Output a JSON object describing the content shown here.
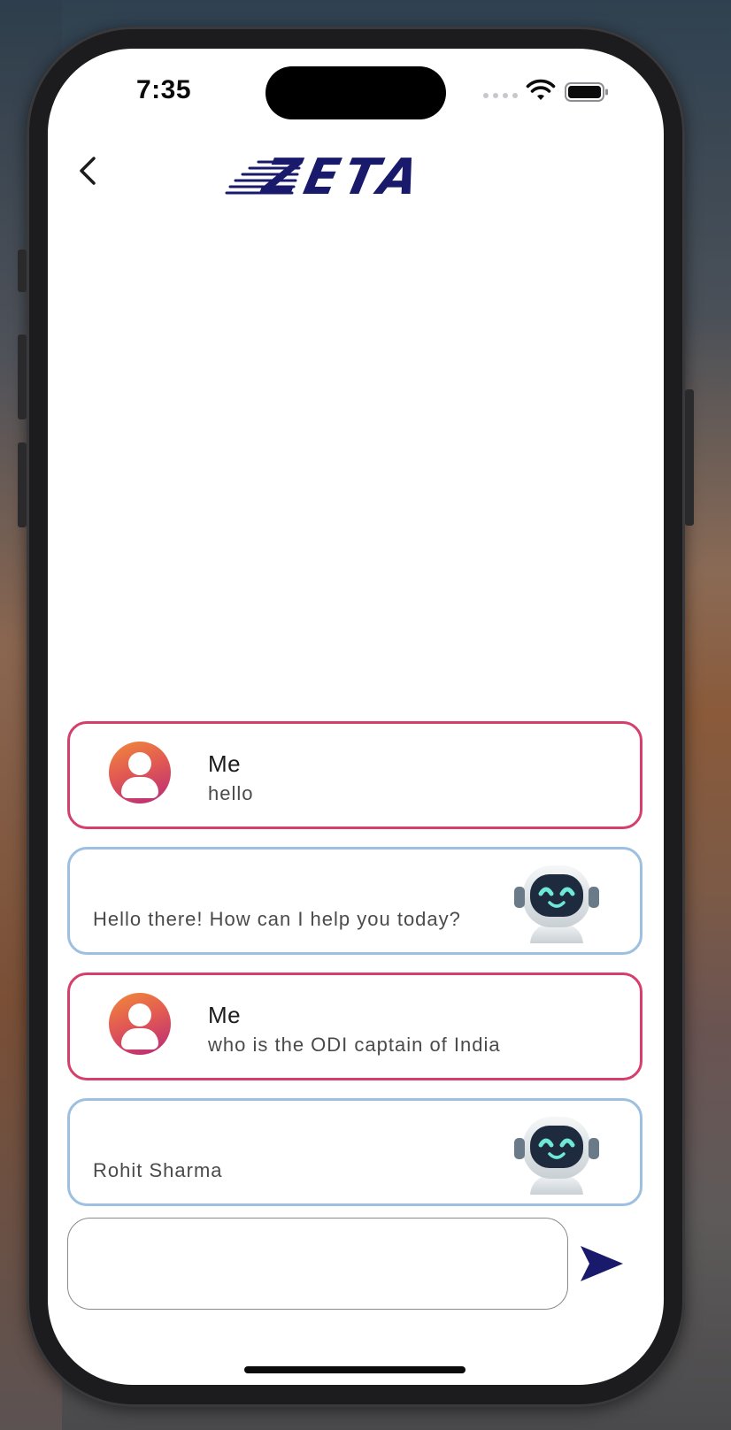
{
  "status_bar": {
    "time": "7:35"
  },
  "header": {
    "logo_text": "ZETA"
  },
  "colors": {
    "brand": "#1a1a6c",
    "user_border": "#d43f6b",
    "bot_border": "#9dbfe0"
  },
  "messages": [
    {
      "role": "user",
      "sender": "Me",
      "text": "hello"
    },
    {
      "role": "bot",
      "text": "Hello there! How can I help you today?"
    },
    {
      "role": "user",
      "sender": "Me",
      "text": "who is the ODI captain of India"
    },
    {
      "role": "bot",
      "text": "Rohit Sharma"
    }
  ],
  "composer": {
    "value": "",
    "placeholder": ""
  },
  "icons": {
    "back": "chevron-left-icon",
    "send": "send-icon",
    "user_avatar": "user-avatar-icon",
    "bot_avatar": "robot-avatar-icon",
    "wifi": "wifi-icon",
    "battery": "battery-icon"
  }
}
